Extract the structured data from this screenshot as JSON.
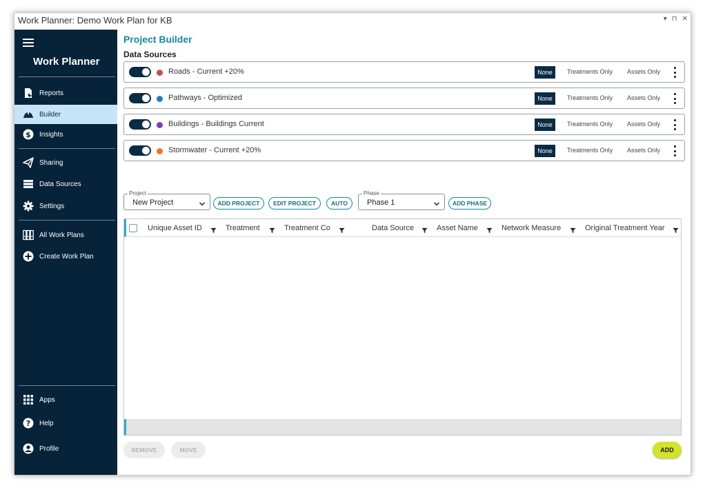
{
  "window": {
    "title": "Work Planner: Demo Work Plan for KB",
    "controls": [
      "▾",
      "⊓",
      "✕"
    ]
  },
  "sidebar": {
    "brand": "Work Planner",
    "items": [
      {
        "label": "Reports",
        "icon": "report-icon"
      },
      {
        "label": "Builder",
        "icon": "builder-helmet-icon",
        "active": true
      },
      {
        "label": "Insights",
        "icon": "dollar-icon"
      },
      {
        "label": "Sharing",
        "icon": "send-icon"
      },
      {
        "label": "Data Sources",
        "icon": "database-icon"
      },
      {
        "label": "Settings",
        "icon": "gear-icon"
      },
      {
        "label": "All Work Plans",
        "icon": "binders-icon"
      },
      {
        "label": "Create Work Plan",
        "icon": "plus-circle-icon"
      },
      {
        "label": "Apps",
        "icon": "apps-grid-icon"
      },
      {
        "label": "Help",
        "icon": "help-icon"
      },
      {
        "label": "Profile",
        "icon": "profile-icon"
      }
    ]
  },
  "main": {
    "title": "Project Builder",
    "data_sources_label": "Data Sources",
    "data_sources": [
      {
        "name": "Roads - Current +20%",
        "color": "#c0504d",
        "enabled": true
      },
      {
        "name": "Pathways - Optimized",
        "color": "#1f7ec4",
        "enabled": true
      },
      {
        "name": "Buildings - Buildings Current",
        "color": "#7b3fb0",
        "enabled": true
      },
      {
        "name": "Stormwater - Current +20%",
        "color": "#e8772e",
        "enabled": true
      }
    ],
    "filter_options": {
      "none": "None",
      "treatments_only": "Treatments Only",
      "assets_only": "Assets Only",
      "selected": "None"
    },
    "project": {
      "legend": "Project",
      "value": "New Project"
    },
    "phase": {
      "legend": "Phase",
      "value": "Phase 1"
    },
    "buttons": {
      "add_project": "ADD PROJECT",
      "edit_project": "EDIT PROJECT",
      "auto": "AUTO",
      "add_phase": "ADD PHASE"
    },
    "columns": [
      "Unique Asset ID",
      "Treatment",
      "Treatment Co",
      "Data Source",
      "Asset Name",
      "Network Measure",
      "Original Treatment Year"
    ],
    "bottom_buttons": {
      "remove": "REMOVE",
      "move": "MOVE",
      "add": "ADD"
    }
  },
  "colors": {
    "sidebar": "#07233a",
    "accent": "#1588a0",
    "toggle": "#0b2a44",
    "add_button": "#d3e32b",
    "active_nav": "#c7e4f6"
  }
}
